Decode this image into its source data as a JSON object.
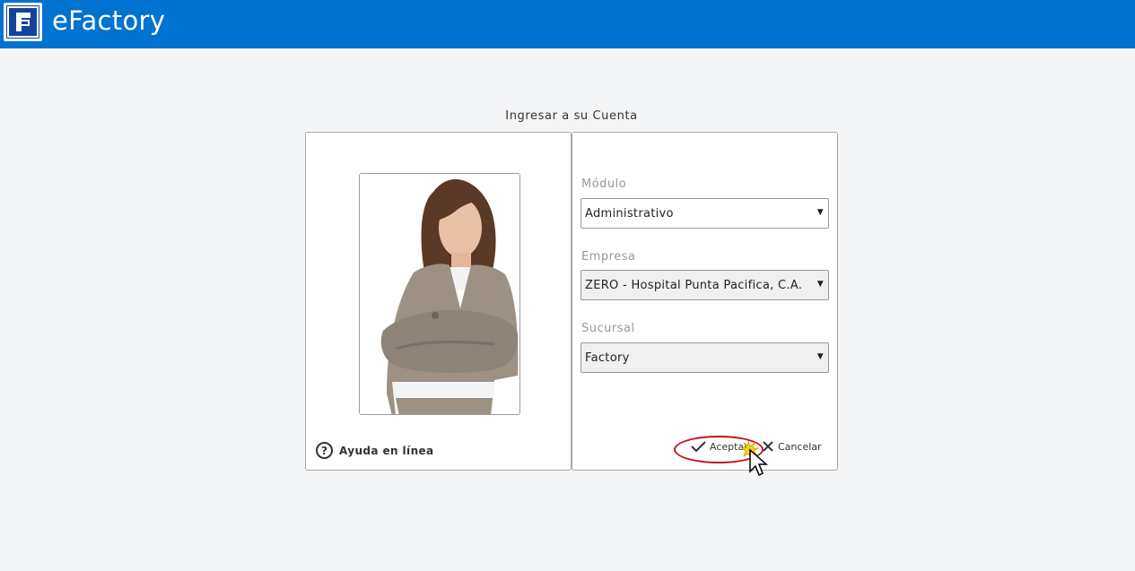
{
  "header": {
    "app_title": "eFactory",
    "logo_icon": "efactory-logo-icon",
    "bar_color": "#0072d0"
  },
  "login": {
    "title": "Ingresar a su Cuenta",
    "help_label": "Ayuda en línea",
    "fields": {
      "modulo": {
        "label": "Módulo",
        "value": "Administrativo"
      },
      "empresa": {
        "label": "Empresa",
        "value": "ZERO - Hospital Punta Pacifica, C.A."
      },
      "sucursal": {
        "label": "Sucursal",
        "value": "Factory"
      }
    },
    "accept_label": "Aceptar",
    "cancel_label": "Cancelar",
    "highlight_color": "#c4161c"
  }
}
